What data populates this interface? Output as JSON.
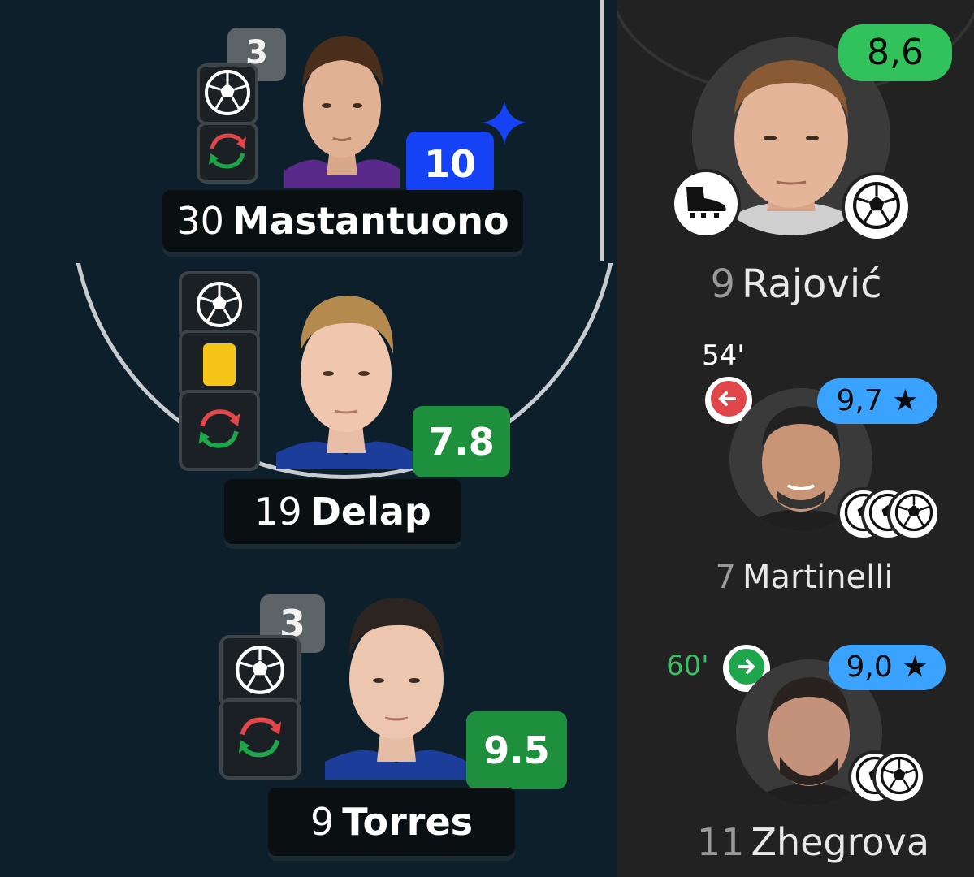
{
  "left": {
    "players": [
      {
        "number": "30",
        "name": "Mastantuono",
        "rating": "10",
        "rating_color": "#1642f5",
        "goals": "3",
        "has_sparkle": true
      },
      {
        "number": "19",
        "name": "Delap",
        "rating": "7.8",
        "rating_color": "#1e8f3c"
      },
      {
        "number": "9",
        "name": "Torres",
        "rating": "9.5",
        "rating_color": "#1e8f3c",
        "goals": "3"
      }
    ]
  },
  "right": {
    "players": [
      {
        "number": "9",
        "name": "Rajović",
        "rating": "8,6",
        "rating_color": "#31c25b"
      },
      {
        "number": "7",
        "name": "Martinelli",
        "rating": "9,7",
        "star": "★",
        "rating_color": "#3aa2ff",
        "sub_minute": "54'",
        "sub_type": "off"
      },
      {
        "number": "11",
        "name": "Zhegrova",
        "rating": "9,0",
        "star": "★",
        "rating_color": "#3aa2ff",
        "sub_minute": "60'",
        "sub_type": "on"
      }
    ]
  },
  "colors": {
    "sub_off_red": "#e0464a",
    "sub_on_green": "#1ea64a",
    "minute_green": "#3cc167",
    "yellow_card": "#f5c518"
  },
  "icons": {
    "goal": "soccer-ball-icon",
    "sub": "substitution-icon",
    "card": "yellow-card-icon",
    "assist": "boot-icon"
  }
}
